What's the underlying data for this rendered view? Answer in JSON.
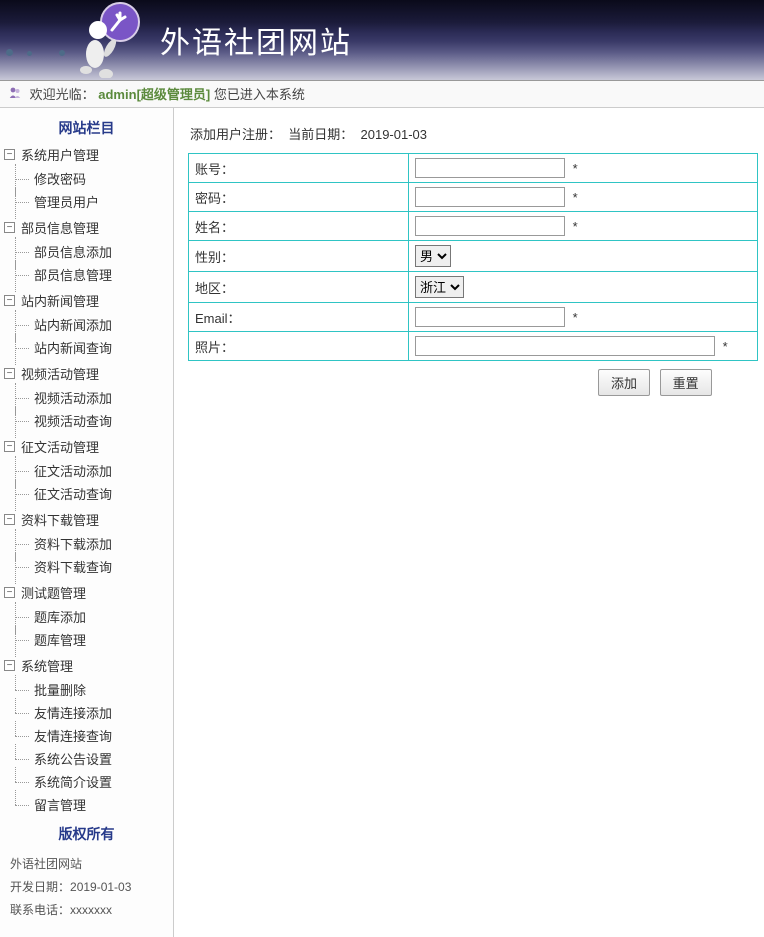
{
  "header": {
    "site_title": "外语社团网站"
  },
  "welcome": {
    "prefix": "欢迎光临：",
    "user": "admin",
    "role": "[超级管理员]",
    "suffix": "您已进入本系统"
  },
  "sidebar": {
    "heading_columns": "网站栏目",
    "categories": [
      {
        "label": "系统用户管理",
        "children": [
          "修改密码",
          "管理员用户"
        ]
      },
      {
        "label": "部员信息管理",
        "children": [
          "部员信息添加",
          "部员信息管理"
        ]
      },
      {
        "label": "站内新闻管理",
        "children": [
          "站内新闻添加",
          "站内新闻查询"
        ]
      },
      {
        "label": "视频活动管理",
        "children": [
          "视频活动添加",
          "视频活动查询"
        ]
      },
      {
        "label": "征文活动管理",
        "children": [
          "征文活动添加",
          "征文活动查询"
        ]
      },
      {
        "label": "资料下载管理",
        "children": [
          "资料下载添加",
          "资料下载查询"
        ]
      },
      {
        "label": "测试题管理",
        "children": [
          "题库添加",
          "题库管理"
        ]
      },
      {
        "label": "系统管理",
        "children": [
          "批量删除",
          "友情连接添加",
          "友情连接查询",
          "系统公告设置",
          "系统简介设置",
          "留言管理"
        ]
      }
    ],
    "heading_copyright": "版权所有",
    "footer": {
      "site_name": "外语社团网站",
      "dev_date_label": "开发日期：",
      "dev_date_value": "2019-01-03",
      "contact_label": "联系电话：",
      "contact_value": "xxxxxxx"
    }
  },
  "content": {
    "title_prefix": "添加用户注册：",
    "date_label": "当前日期：",
    "date_value": "2019-01-03",
    "fields": {
      "account": "账号：",
      "password": "密码：",
      "name": "姓名：",
      "gender": "性别：",
      "region": "地区：",
      "email": "Email：",
      "photo": "照片："
    },
    "gender_option": "男",
    "region_option": "浙江",
    "required_mark": "*",
    "btn_add": "添加",
    "btn_reset": "重置"
  }
}
